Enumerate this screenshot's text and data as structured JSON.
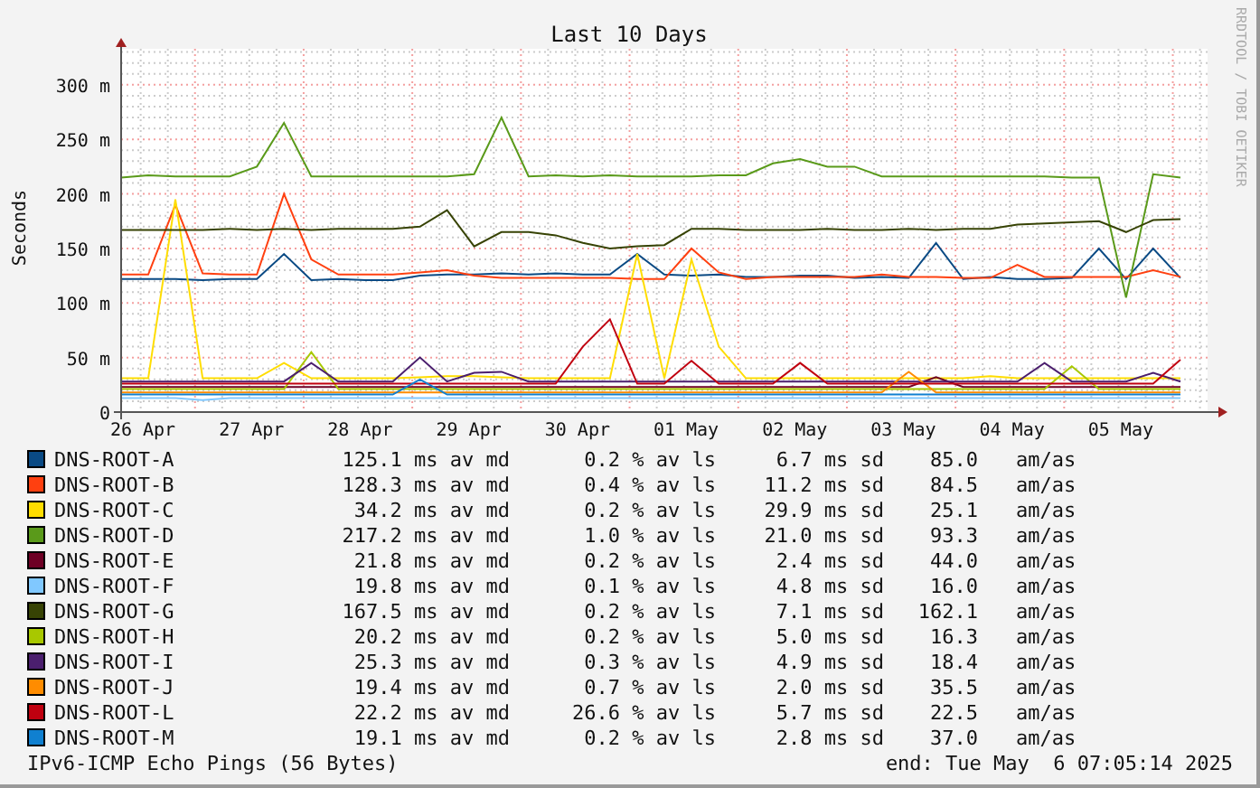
{
  "chart": {
    "watermark": "RRDTOOL / TOBI OETIKER",
    "chart_data": {
      "type": "line",
      "title": "Last 10 Days",
      "ylabel": "Seconds",
      "grid": true,
      "ylim": [
        0,
        333
      ],
      "categories": [
        null,
        "26 Apr",
        null,
        null,
        null,
        "27 Apr",
        null,
        null,
        null,
        "28 Apr",
        null,
        null,
        null,
        "29 Apr",
        null,
        null,
        null,
        "30 Apr",
        null,
        null,
        null,
        "01 May",
        null,
        null,
        null,
        "02 May",
        null,
        null,
        null,
        "03 May",
        null,
        null,
        null,
        "04 May",
        null,
        null,
        null,
        "05 May",
        null,
        null
      ],
      "yticks": [
        {
          "value": 0,
          "label": "0"
        },
        {
          "value": 50,
          "label": "50 m"
        },
        {
          "value": 100,
          "label": "100 m"
        },
        {
          "value": 150,
          "label": "150 m"
        },
        {
          "value": 200,
          "label": "200 m"
        },
        {
          "value": 250,
          "label": "250 m"
        },
        {
          "value": 300,
          "label": "300 m"
        }
      ],
      "series": [
        {
          "name": "DNS-ROOT-A",
          "color": "#0a4a84",
          "values": [
            122,
            122,
            122,
            121,
            122,
            122,
            145,
            121,
            122,
            121,
            121,
            125,
            126,
            126,
            127,
            126,
            127,
            126,
            126,
            145,
            126,
            125,
            126,
            124,
            124,
            125,
            125,
            123,
            124,
            123,
            155,
            122,
            124,
            122,
            122,
            123,
            150,
            122,
            150,
            123
          ]
        },
        {
          "name": "DNS-ROOT-B",
          "color": "#ff4010",
          "values": [
            126,
            126,
            190,
            127,
            126,
            126,
            200,
            140,
            126,
            126,
            126,
            128,
            130,
            125,
            123,
            123,
            123,
            123,
            123,
            122,
            122,
            150,
            128,
            122,
            124,
            124,
            124,
            124,
            126,
            124,
            124,
            123,
            123,
            135,
            124,
            124,
            124,
            124,
            130,
            124
          ]
        },
        {
          "name": "DNS-ROOT-C",
          "color": "#ffdd00",
          "values": [
            31,
            31,
            195,
            31,
            31,
            31,
            45,
            31,
            31,
            31,
            31,
            32,
            33,
            33,
            32,
            31,
            31,
            31,
            31,
            145,
            31,
            140,
            60,
            31,
            31,
            31,
            31,
            31,
            31,
            31,
            31,
            31,
            33,
            31,
            31,
            31,
            31,
            31,
            31,
            31
          ]
        },
        {
          "name": "DNS-ROOT-D",
          "color": "#5a9a1a",
          "values": [
            215,
            217,
            216,
            216,
            216,
            225,
            265,
            216,
            216,
            216,
            216,
            216,
            216,
            218,
            270,
            216,
            217,
            216,
            217,
            216,
            216,
            216,
            217,
            217,
            228,
            232,
            225,
            225,
            216,
            216,
            216,
            216,
            216,
            216,
            216,
            215,
            215,
            105,
            218,
            215
          ]
        },
        {
          "name": "DNS-ROOT-E",
          "color": "#6e0025",
          "values": [
            23,
            23,
            23,
            23,
            23,
            23,
            23,
            23,
            23,
            23,
            23,
            23,
            23,
            23,
            23,
            23,
            23,
            23,
            23,
            23,
            23,
            23,
            23,
            23,
            23,
            23,
            23,
            23,
            23,
            23,
            32,
            23,
            23,
            23,
            23,
            23,
            23,
            23,
            23,
            23
          ]
        },
        {
          "name": "DNS-ROOT-F",
          "color": "#80c8ff",
          "values": [
            13,
            13,
            13,
            11,
            13,
            13,
            13,
            13,
            13,
            13,
            13,
            13,
            13,
            13,
            13,
            13,
            13,
            13,
            13,
            13,
            13,
            13,
            13,
            13,
            13,
            13,
            13,
            13,
            13,
            13,
            13,
            13,
            13,
            13,
            13,
            13,
            13,
            13,
            13,
            13
          ]
        },
        {
          "name": "DNS-ROOT-G",
          "color": "#374304",
          "values": [
            167,
            167,
            167,
            167,
            168,
            167,
            168,
            167,
            168,
            168,
            168,
            170,
            185,
            152,
            165,
            165,
            162,
            155,
            150,
            152,
            153,
            168,
            168,
            167,
            167,
            167,
            168,
            167,
            167,
            168,
            167,
            168,
            168,
            172,
            173,
            174,
            175,
            165,
            176,
            177
          ]
        },
        {
          "name": "DNS-ROOT-H",
          "color": "#a8c800",
          "values": [
            21,
            21,
            21,
            21,
            21,
            21,
            21,
            55,
            21,
            21,
            21,
            21,
            21,
            21,
            21,
            21,
            21,
            21,
            21,
            21,
            21,
            21,
            21,
            21,
            21,
            21,
            21,
            21,
            21,
            21,
            21,
            21,
            21,
            21,
            21,
            42,
            21,
            21,
            21,
            21
          ]
        },
        {
          "name": "DNS-ROOT-I",
          "color": "#4b1f6e",
          "values": [
            28,
            28,
            28,
            28,
            28,
            28,
            28,
            45,
            28,
            28,
            28,
            50,
            28,
            36,
            37,
            28,
            28,
            28,
            28,
            28,
            28,
            28,
            28,
            28,
            28,
            28,
            28,
            28,
            28,
            28,
            28,
            28,
            28,
            28,
            45,
            28,
            28,
            28,
            36,
            28
          ]
        },
        {
          "name": "DNS-ROOT-J",
          "color": "#ff8c00",
          "values": [
            18,
            18,
            18,
            18,
            18,
            18,
            18,
            18,
            18,
            18,
            18,
            18,
            18,
            18,
            18,
            18,
            18,
            18,
            18,
            18,
            18,
            18,
            18,
            18,
            18,
            18,
            18,
            18,
            18,
            37,
            18,
            18,
            18,
            18,
            18,
            18,
            18,
            18,
            18,
            18
          ]
        },
        {
          "name": "DNS-ROOT-L",
          "color": "#c0000f",
          "values": [
            26,
            26,
            26,
            26,
            26,
            26,
            26,
            26,
            26,
            26,
            26,
            26,
            26,
            26,
            26,
            26,
            26,
            60,
            85,
            26,
            26,
            47,
            26,
            26,
            26,
            45,
            26,
            26,
            26,
            26,
            26,
            26,
            26,
            26,
            26,
            26,
            26,
            26,
            26,
            48
          ]
        },
        {
          "name": "DNS-ROOT-M",
          "color": "#1080d0",
          "values": [
            16,
            16,
            16,
            16,
            16,
            16,
            16,
            16,
            16,
            16,
            16,
            30,
            16,
            16,
            16,
            16,
            16,
            16,
            16,
            16,
            16,
            16,
            16,
            16,
            16,
            16,
            16,
            16,
            16,
            16,
            16,
            16,
            16,
            16,
            16,
            16,
            16,
            16,
            16,
            16
          ]
        }
      ]
    }
  },
  "legend": [
    {
      "median": "125.1 ms av md",
      "loss": "0.2 % av ls",
      "sd": "6.7 ms sd",
      "ratio": "85.0",
      "ratio_unit": "am/as"
    },
    {
      "median": "128.3 ms av md",
      "loss": "0.4 % av ls",
      "sd": "11.2 ms sd",
      "ratio": "84.5",
      "ratio_unit": "am/as"
    },
    {
      "median": "34.2 ms av md",
      "loss": "0.2 % av ls",
      "sd": "29.9 ms sd",
      "ratio": "25.1",
      "ratio_unit": "am/as"
    },
    {
      "median": "217.2 ms av md",
      "loss": "1.0 % av ls",
      "sd": "21.0 ms sd",
      "ratio": "93.3",
      "ratio_unit": "am/as"
    },
    {
      "median": "21.8 ms av md",
      "loss": "0.2 % av ls",
      "sd": "2.4 ms sd",
      "ratio": "44.0",
      "ratio_unit": "am/as"
    },
    {
      "median": "19.8 ms av md",
      "loss": "0.1 % av ls",
      "sd": "4.8 ms sd",
      "ratio": "16.0",
      "ratio_unit": "am/as"
    },
    {
      "median": "167.5 ms av md",
      "loss": "0.2 % av ls",
      "sd": "7.1 ms sd",
      "ratio": "162.1",
      "ratio_unit": "am/as"
    },
    {
      "median": "20.2 ms av md",
      "loss": "0.2 % av ls",
      "sd": "5.0 ms sd",
      "ratio": "16.3",
      "ratio_unit": "am/as"
    },
    {
      "median": "25.3 ms av md",
      "loss": "0.3 % av ls",
      "sd": "4.9 ms sd",
      "ratio": "18.4",
      "ratio_unit": "am/as"
    },
    {
      "median": "19.4 ms av md",
      "loss": "0.7 % av ls",
      "sd": "2.0 ms sd",
      "ratio": "35.5",
      "ratio_unit": "am/as"
    },
    {
      "median": "22.2 ms av md",
      "loss": "26.6 % av ls",
      "sd": "5.7 ms sd",
      "ratio": "22.5",
      "ratio_unit": "am/as"
    },
    {
      "median": "19.1 ms av md",
      "loss": "0.2 % av ls",
      "sd": "2.8 ms sd",
      "ratio": "37.0",
      "ratio_unit": "am/as"
    }
  ],
  "footer": {
    "probe": "IPv6-ICMP Echo Pings (56 Bytes)",
    "end": "end: Tue May  6 07:05:14 2025"
  }
}
